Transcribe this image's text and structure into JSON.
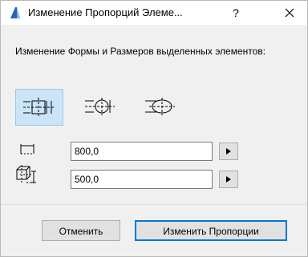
{
  "window": {
    "title": "Изменение Пропорций Элеме...",
    "help_label": "?"
  },
  "heading": "Изменение Формы и Размеров выделенных элементов:",
  "mode_buttons": [
    {
      "icon": "stretch-box-icon",
      "selected": true
    },
    {
      "icon": "stretch-circle-icon",
      "selected": false
    },
    {
      "icon": "stretch-ellipse-icon",
      "selected": false
    }
  ],
  "fields": {
    "width_value": "800,0",
    "height_value": "500,0"
  },
  "buttons": {
    "cancel_label": "Отменить",
    "ok_label": "Изменить Пропорции"
  },
  "colors": {
    "accent": "#0078d7",
    "selected_bg": "#cce4f7",
    "app_icon": "#2b66b5"
  }
}
